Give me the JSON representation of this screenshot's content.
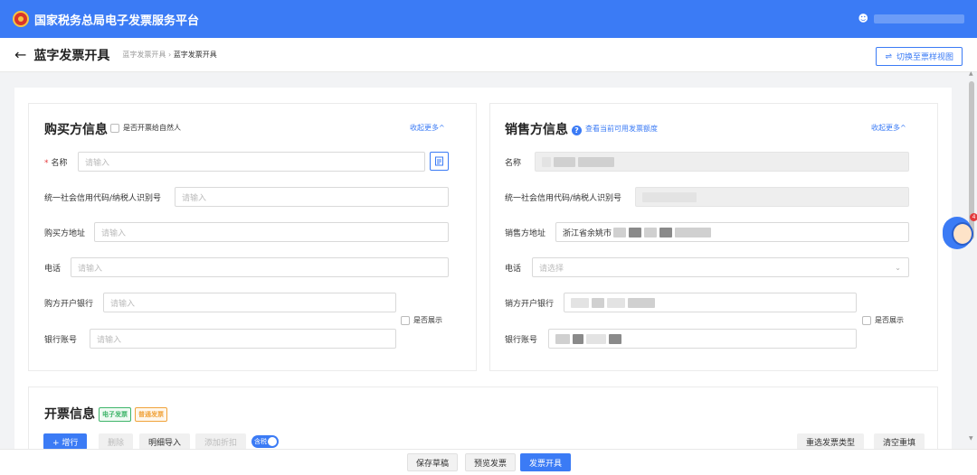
{
  "header": {
    "app_title": "国家税务总局电子发票服务平台",
    "user_icon": "user-icon"
  },
  "page": {
    "title": "蓝字发票开具",
    "breadcrumb": [
      "蓝字发票开具",
      "蓝字发票开具"
    ],
    "breadcrumb_sep": "›",
    "switch_view_label": "切换至票样视图",
    "switch_icon": "swap-icon"
  },
  "buyer": {
    "title": "购买方信息",
    "natural_person_label": "是否开票给自然人",
    "collapse_label": "收起更多^",
    "name_label": "名称",
    "name_placeholder": "请输入",
    "credit_label": "统一社会信用代码/纳税人识别号",
    "credit_placeholder": "请输入",
    "address_label": "购买方地址",
    "address_placeholder": "请输入",
    "phone_label": "电话",
    "phone_placeholder": "请输入",
    "bank_label": "购方开户银行",
    "bank_placeholder": "请输入",
    "account_label": "银行账号",
    "account_placeholder": "请输入",
    "show_label": "是否展示"
  },
  "seller": {
    "title": "销售方信息",
    "quota_link": "查看当前可用发票额度",
    "collapse_label": "收起更多^",
    "name_label": "名称",
    "credit_label": "统一社会信用代码/纳税人识别号",
    "address_label": "销售方地址",
    "address_value": "浙江省余姚市",
    "phone_label": "电话",
    "phone_placeholder": "请选择",
    "bank_label": "销方开户银行",
    "account_label": "银行账号",
    "show_label": "是否展示"
  },
  "invoice": {
    "title": "开票信息",
    "tag_electronic": "电子发票",
    "tag_normal": "普通发票",
    "add_row": "+ 增行",
    "delete": "删除",
    "import_detail": "明细导入",
    "add_discount": "添加折扣",
    "tax_toggle": "含税",
    "reselect_type": "重选发票类型",
    "clear_refill": "清空重填"
  },
  "footer": {
    "save_draft": "保存草稿",
    "preview": "预览发票",
    "issue": "发票开具"
  },
  "assistant": {
    "badge": "4"
  }
}
